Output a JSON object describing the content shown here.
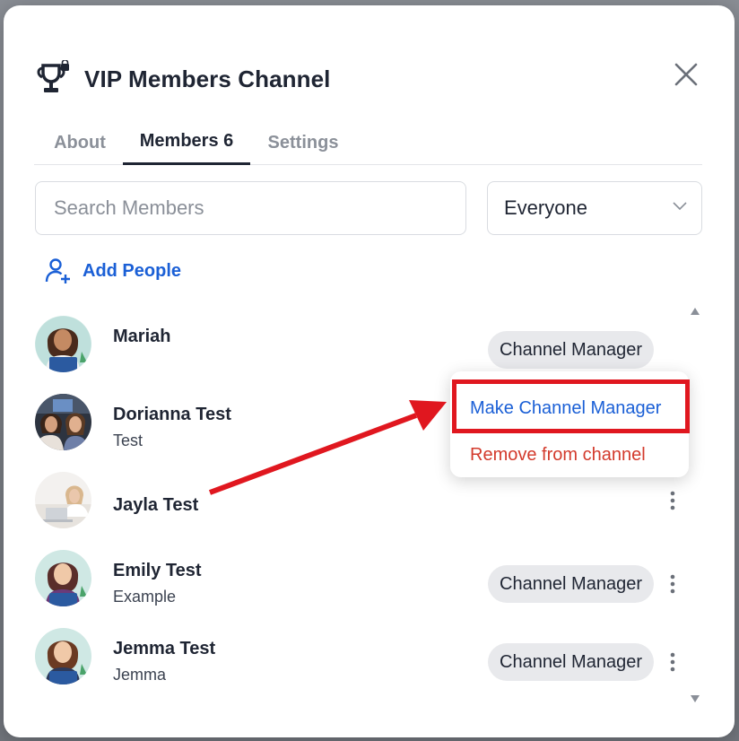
{
  "modal": {
    "title": "VIP Members Channel",
    "icon": "trophy-lock-icon"
  },
  "tabs": [
    {
      "label": "About",
      "active": false
    },
    {
      "label": "Members 6",
      "active": true
    },
    {
      "label": "Settings",
      "active": false
    }
  ],
  "search": {
    "placeholder": "Search Members"
  },
  "filter": {
    "selected": "Everyone"
  },
  "add_people": {
    "label": "Add People"
  },
  "members": [
    {
      "name": "Mariah",
      "subtitle": "",
      "badge": "Channel Manager",
      "avatar": "illustrated-woman-laptop"
    },
    {
      "name": "Dorianna Test",
      "subtitle": "Test",
      "badge": "",
      "avatar": "photo-two-women"
    },
    {
      "name": "Jayla Test",
      "subtitle": "",
      "badge": "",
      "avatar": "photo-woman-laptop"
    },
    {
      "name": "Emily Test",
      "subtitle": "Example",
      "badge": "Channel Manager",
      "avatar": "illustrated-woman-laptop"
    },
    {
      "name": "Jemma Test",
      "subtitle": "Jemma",
      "badge": "Channel Manager",
      "avatar": "illustrated-woman-laptop"
    }
  ],
  "context_menu": {
    "make_manager": "Make Channel Manager",
    "remove": "Remove from channel"
  },
  "colors": {
    "accent_blue": "#1a5fd6",
    "danger_red": "#d33a2c",
    "annotation_red": "#e0171f",
    "text_dark": "#1f2533"
  }
}
